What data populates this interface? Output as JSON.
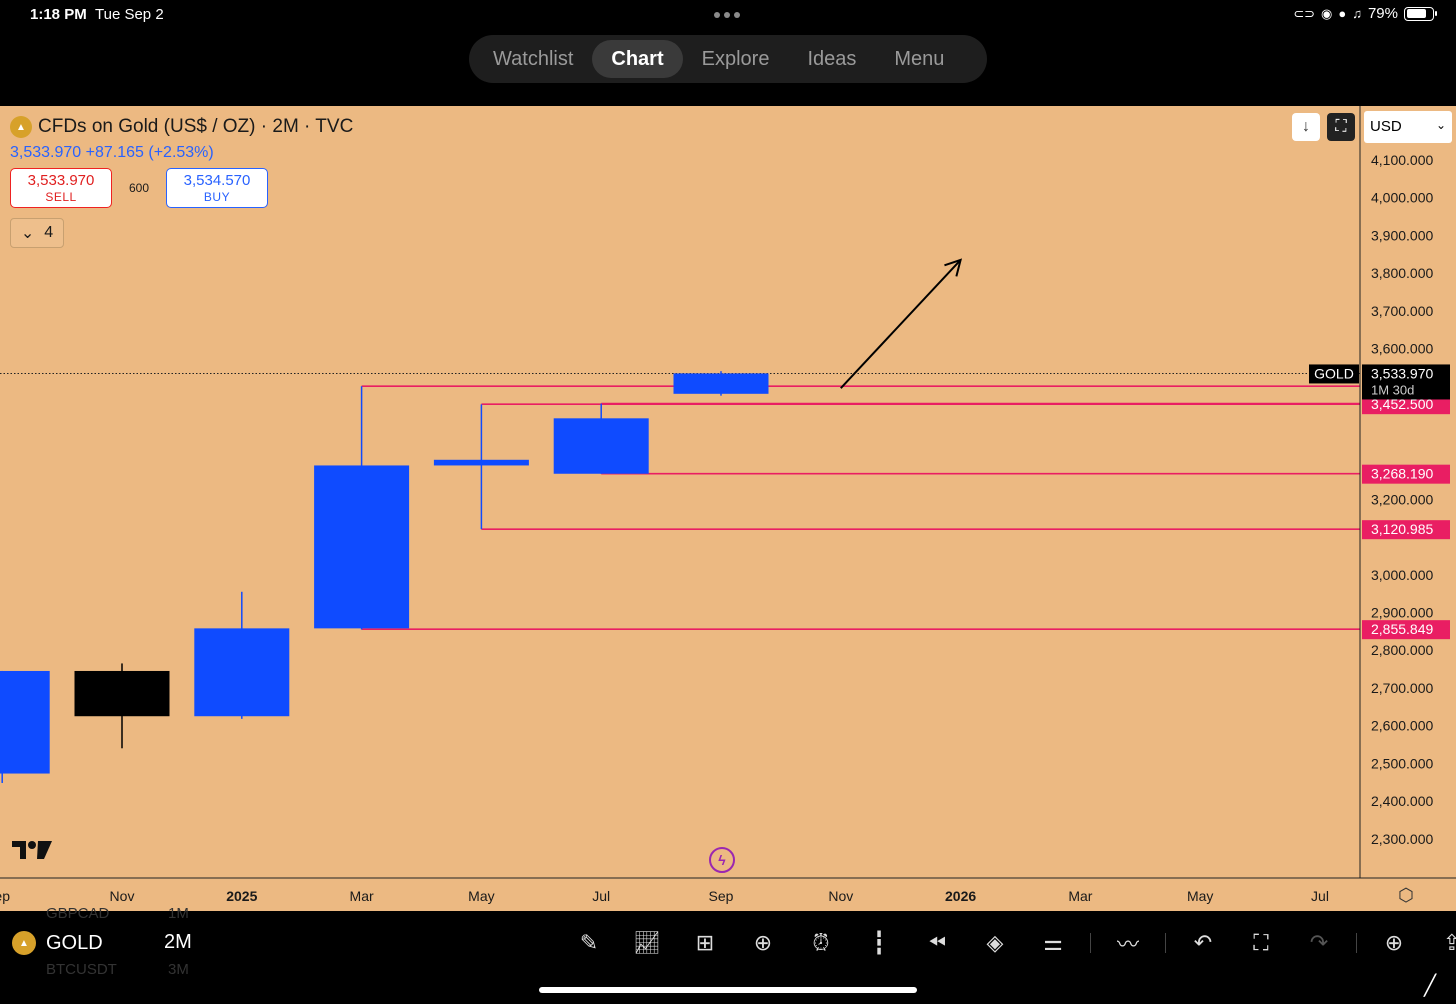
{
  "status": {
    "time": "1:18 PM",
    "date": "Tue Sep 2",
    "battery": "79%",
    "battery_level": 0.79
  },
  "nav": {
    "items": [
      {
        "label": "Watchlist",
        "active": false
      },
      {
        "label": "Chart",
        "active": true
      },
      {
        "label": "Explore",
        "active": false
      },
      {
        "label": "Ideas",
        "active": false
      },
      {
        "label": "Menu",
        "active": false
      }
    ]
  },
  "legend": {
    "title": "CFDs on Gold (US$ / OZ) · 2M · TVC",
    "last_price": "3,533.970",
    "change": "+87.165 (+2.53%)",
    "sell_price": "3,533.970",
    "sell_label": "SELL",
    "spread": "600",
    "buy_price": "3,534.570",
    "buy_label": "BUY",
    "indicators_count": "4"
  },
  "currency": "USD",
  "price_badge": {
    "symbol": "GOLD",
    "price": "3,533.970",
    "countdown": "1M 30d"
  },
  "colors": {
    "background": "#ecb982",
    "up_candle": "#0f4bff",
    "down_candle": "#000000",
    "level_line": "#e91e63",
    "arrow": "#000000"
  },
  "chart_data": {
    "type": "candlestick",
    "symbol": "GOLD",
    "timeframe": "2M",
    "y_range": [
      2210,
      4160
    ],
    "y_ticks": [
      {
        "value": 4100,
        "label": "4,100.000"
      },
      {
        "value": 4000,
        "label": "4,000.000"
      },
      {
        "value": 3900,
        "label": "3,900.000"
      },
      {
        "value": 3800,
        "label": "3,800.000"
      },
      {
        "value": 3700,
        "label": "3,700.000"
      },
      {
        "value": 3600,
        "label": "3,600.000"
      },
      {
        "value": 3200,
        "label": "3,200.000"
      },
      {
        "value": 3000,
        "label": "3,000.000"
      },
      {
        "value": 2900,
        "label": "2,900.000"
      },
      {
        "value": 2800,
        "label": "2,800.000"
      },
      {
        "value": 2700,
        "label": "2,700.000"
      },
      {
        "value": 2600,
        "label": "2,600.000"
      },
      {
        "value": 2500,
        "label": "2,500.000"
      },
      {
        "value": 2400,
        "label": "2,400.000"
      },
      {
        "value": 2300,
        "label": "2,300.000"
      }
    ],
    "x_ticks": [
      {
        "month": -1,
        "label": "ep",
        "bold": false
      },
      {
        "month": 1,
        "label": "Nov",
        "bold": false
      },
      {
        "month": 3,
        "label": "2025",
        "bold": true
      },
      {
        "month": 5,
        "label": "Mar",
        "bold": false
      },
      {
        "month": 7,
        "label": "May",
        "bold": false
      },
      {
        "month": 9,
        "label": "Jul",
        "bold": false
      },
      {
        "month": 11,
        "label": "Sep",
        "bold": false
      },
      {
        "month": 13,
        "label": "Nov",
        "bold": false
      },
      {
        "month": 15,
        "label": "2026",
        "bold": true
      },
      {
        "month": 17,
        "label": "Mar",
        "bold": false
      },
      {
        "month": 19,
        "label": "May",
        "bold": false
      },
      {
        "month": 21,
        "label": "Jul",
        "bold": false
      }
    ],
    "candles": [
      {
        "period": "2024-09",
        "month": -1,
        "open": 2473,
        "high": 2685,
        "low": 2448,
        "close": 2745
      },
      {
        "period": "2024-11",
        "month": 1,
        "open": 2745,
        "high": 2765,
        "low": 2540,
        "close": 2625
      },
      {
        "period": "2025-01",
        "month": 3,
        "open": 2625,
        "high": 2955,
        "low": 2618,
        "close": 2858
      },
      {
        "period": "2025-03",
        "month": 5,
        "open": 2858,
        "high": 3500,
        "low": 2855,
        "close": 3290
      },
      {
        "period": "2025-05",
        "month": 7,
        "open": 3290,
        "high": 3452,
        "low": 3121,
        "close": 3305
      },
      {
        "period": "2025-07",
        "month": 9,
        "open": 3268,
        "high": 3454,
        "low": 3268,
        "close": 3415
      },
      {
        "period": "2025-09",
        "month": 11,
        "open": 3480,
        "high": 3540,
        "low": 3475,
        "close": 3534
      }
    ],
    "levels": [
      {
        "value": 3500.12,
        "label": "3,500.120",
        "from_month": 5
      },
      {
        "value": 3454.06,
        "label": "3,454.060",
        "from_month": 9
      },
      {
        "value": 3452.5,
        "label": "3,452.500",
        "from_month": 7
      },
      {
        "value": 3268.19,
        "label": "3,268.190",
        "from_month": 9
      },
      {
        "value": 3120.985,
        "label": "3,120.985",
        "from_month": 7
      },
      {
        "value": 2855.849,
        "label": "2,855.849",
        "from_month": 5
      }
    ],
    "current_price": 3533.97,
    "projection_arrow": {
      "from": {
        "month": 13,
        "value": 3495
      },
      "to": {
        "month": 15,
        "value": 3835
      }
    }
  },
  "bottom": {
    "symbol": "GOLD",
    "timeframe": "2M",
    "ghost_top_symbol": "GBPCAD",
    "ghost_top_tf": "1M",
    "ghost_bottom_symbol": "BTCUSDT",
    "ghost_bottom_tf": "3M",
    "tools": [
      "draw-icon",
      "indicators-icon",
      "layouts-icon",
      "add-icon",
      "alert-icon",
      "candle-type-icon",
      "replay-icon",
      "layers-icon",
      "settings-sliders-icon",
      "compare-icon",
      "undo-icon",
      "fullscreen-icon",
      "redo-icon",
      "add-idea-icon",
      "share-icon"
    ]
  }
}
